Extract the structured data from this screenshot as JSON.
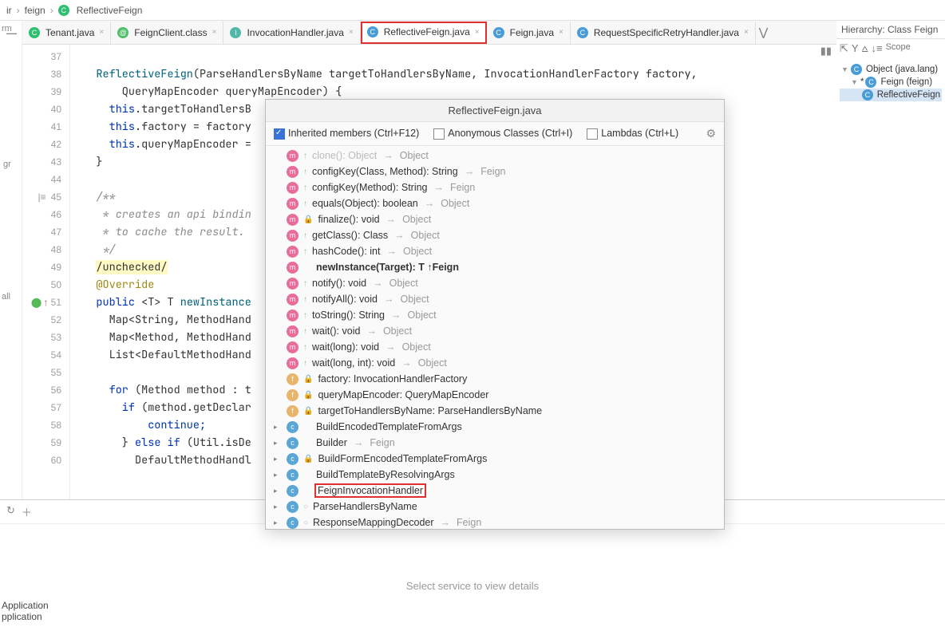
{
  "breadcrumb": {
    "seg1": "ir",
    "seg2": "feign",
    "seg3": "ReflectiveFeign"
  },
  "hierarchy": {
    "title": "Hierarchy:  Class Feign",
    "scope": "Scope",
    "n0": "Object (java.lang)",
    "n1": "Feign (feign)",
    "n2": "ReflectiveFeign"
  },
  "tabs": {
    "t0": "Tenant.java",
    "t1": "FeignClient.class",
    "t2": "InvocationHandler.java",
    "t3": "ReflectiveFeign.java",
    "t4": "Feign.java",
    "t5": "RequestSpecificRetryHandler.java"
  },
  "popup": {
    "title": "ReflectiveFeign.java",
    "inherited": "Inherited members (Ctrl+F12)",
    "anon": "Anonymous Classes (Ctrl+I)",
    "lambdas": "Lambdas (Ctrl+L)"
  },
  "members": [
    {
      "k": "m",
      "i": true,
      "txt": "clone(): Object",
      "ret": "Object",
      "faded": true
    },
    {
      "k": "m",
      "i": true,
      "txt": "configKey(Class, Method): String",
      "ret": "Feign"
    },
    {
      "k": "m",
      "i": true,
      "txt": "configKey(Method): String",
      "ret": "Feign"
    },
    {
      "k": "m",
      "i": true,
      "txt": "equals(Object): boolean",
      "ret": "Object"
    },
    {
      "k": "m",
      "i": true,
      "txt": "finalize(): void",
      "ret": "Object",
      "lock": true
    },
    {
      "k": "m",
      "i": true,
      "txt": "getClass(): Class<?>",
      "ret": "Object"
    },
    {
      "k": "m",
      "i": true,
      "txt": "hashCode(): int",
      "ret": "Object"
    },
    {
      "k": "m",
      "i": false,
      "txt": "newInstance(Target<T>): T ↑Feign",
      "bold": true
    },
    {
      "k": "m",
      "i": true,
      "txt": "notify(): void",
      "ret": "Object"
    },
    {
      "k": "m",
      "i": true,
      "txt": "notifyAll(): void",
      "ret": "Object"
    },
    {
      "k": "m",
      "i": true,
      "txt": "toString(): String",
      "ret": "Object"
    },
    {
      "k": "m",
      "i": true,
      "txt": "wait(): void",
      "ret": "Object"
    },
    {
      "k": "m",
      "i": true,
      "txt": "wait(long): void",
      "ret": "Object"
    },
    {
      "k": "m",
      "i": true,
      "txt": "wait(long, int): void",
      "ret": "Object"
    },
    {
      "k": "f",
      "lock": true,
      "txt": "factory: InvocationHandlerFactory"
    },
    {
      "k": "f",
      "lock": true,
      "txt": "queryMapEncoder: QueryMapEncoder"
    },
    {
      "k": "f",
      "lock": true,
      "txt": "targetToHandlersByName: ParseHandlersByName"
    },
    {
      "k": "c",
      "tri": true,
      "txt": "BuildEncodedTemplateFromArgs"
    },
    {
      "k": "c",
      "tri": true,
      "txt": "Builder",
      "ret": "Feign"
    },
    {
      "k": "c",
      "tri": true,
      "lock": true,
      "txt": "BuildFormEncodedTemplateFromArgs"
    },
    {
      "k": "c",
      "tri": true,
      "txt": "BuildTemplateByResolvingArgs"
    },
    {
      "k": "c",
      "tri": true,
      "txt": "FeignInvocationHandler",
      "hl": true
    },
    {
      "k": "c",
      "tri": true,
      "txt": "ParseHandlersByName",
      "dim": true
    },
    {
      "k": "c",
      "tri": true,
      "txt": "ResponseMappingDecoder",
      "ret": "Feign",
      "dim": true
    }
  ],
  "code": {
    "l37": "",
    "l38a": "ReflectiveFeign",
    "l38b": "(ParseHandlersByName targetToHandlersByName, InvocationHandlerFactory factory,",
    "l39": "        QueryMapEncoder queryMapEncoder) {",
    "l40a": "this",
    "l40b": ".targetToHandlersB",
    "l41a": "this",
    "l41b": ".factory = factory",
    "l42a": "this",
    "l42b": ".queryMapEncoder =",
    "l43": "}",
    "l44": "",
    "l45": "/**",
    "l46": " * creates an api bindin",
    "l47": " * to cache the result.",
    "l48": " */",
    "l49": "/unchecked/",
    "l50": "@Override",
    "l51a": "public ",
    "l51b": "<T> T ",
    "l51c": "newInstance",
    "l52": "  Map<String, MethodHand",
    "l53": "  Map<Method, MethodHand",
    "l54": "  List<DefaultMethodHand",
    "l55": "",
    "l56a": "  for ",
    "l56b": "(Method method : t",
    "l57a": "    if ",
    "l57b": "(method.getDeclar",
    "l58": "      continue;",
    "l59a": "    } ",
    "l59b": "else if ",
    "l59c": "(Util.isDe",
    "l60": "      DefaultMethodHandl"
  },
  "gutter": [
    "37",
    "38",
    "39",
    "40",
    "41",
    "42",
    "43",
    "44",
    "45",
    "46",
    "47",
    "48",
    "49",
    "50",
    "51",
    "52",
    "53",
    "54",
    "55",
    "56",
    "57",
    "58",
    "59",
    "60"
  ],
  "bottom": {
    "msg": "Select service to view details",
    "run1": "Application",
    "run2": "pplication"
  },
  "left": {
    "gr": "gr",
    "all": "all",
    "rm": "rm"
  }
}
